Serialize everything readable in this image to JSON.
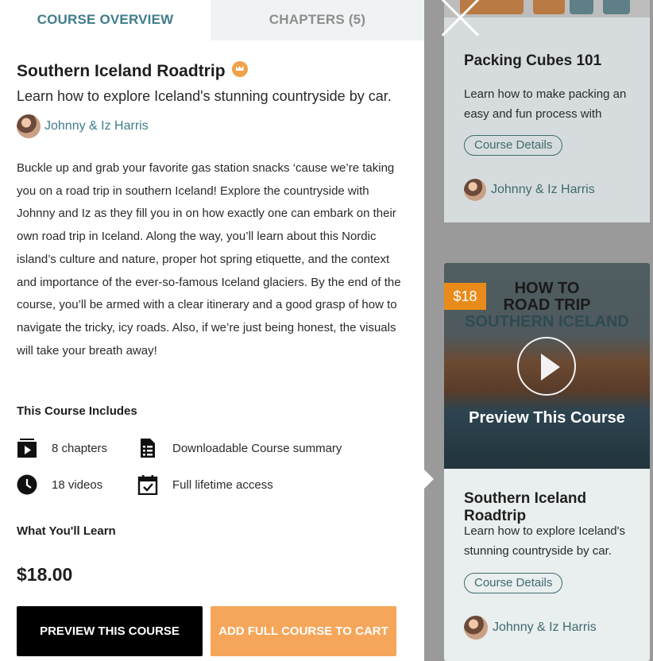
{
  "tabs": {
    "overview": "COURSE OVERVIEW",
    "chapters": "CHAPTERS (5)"
  },
  "course": {
    "title": "Southern Iceland Roadtrip",
    "subtitle": "Learn how to explore Iceland's stunning countryside by car.",
    "author": "Johnny & Iz Harris",
    "description": "Buckle up and grab your favorite gas station snacks ‘cause we’re taking you on a road trip in southern Iceland! Explore the countryside with Johnny and Iz as they fill you in on how exactly one can embark on their own road trip in Iceland. Along the way, you’ll learn about this Nordic island’s culture and nature, proper hot spring etiquette, and the context and importance of the ever-so-famous Iceland glaciers. By the end of the course, you’ll be armed with a clear itinerary and a good grasp of how to navigate the tricky, icy roads. Also, if we’re just being honest, the visuals will take your breath away!",
    "includes_heading": "This Course Includes",
    "features": [
      {
        "icon": "video-chapters-icon",
        "label": "8 chapters"
      },
      {
        "icon": "document-list-icon",
        "label": "Downloadable Course summary"
      },
      {
        "icon": "clock-icon",
        "label": "18 videos"
      },
      {
        "icon": "calendar-check-icon",
        "label": "Full lifetime access"
      }
    ],
    "learn_heading": "What You'll Learn",
    "price": "$18.00",
    "preview_button": "PREVIEW THIS COURSE",
    "cart_button": "ADD FULL COURSE TO CART"
  },
  "background_cards": {
    "card1": {
      "title": "Packing Cubes 101",
      "description": "Learn how to make packing an easy and fun process with",
      "details": "Course Details",
      "author": "Johnny & Iz Harris"
    },
    "card2": {
      "price_badge": "$18",
      "video_title_1": "HOW TO",
      "video_title_2": "ROAD TRIP",
      "video_title_3": "SOUTHERN ICELAND",
      "preview_label": "Preview This Course",
      "title": "Southern Iceland Roadtrip",
      "description": "Learn how to explore Iceland's stunning countryside by car.",
      "details": "Course Details",
      "author": "Johnny & Iz Harris"
    }
  },
  "colors": {
    "accent": "#3f7c8c",
    "cart": "#f6a65a",
    "badge": "#e98b1a"
  }
}
